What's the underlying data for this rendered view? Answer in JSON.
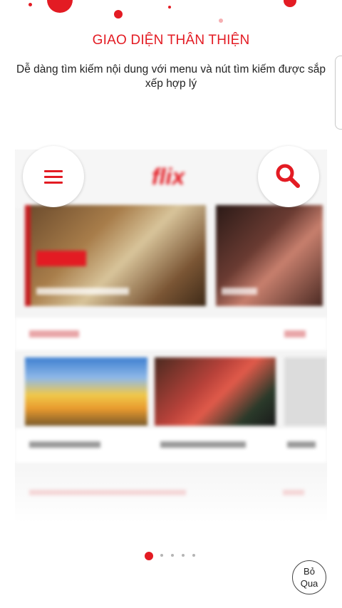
{
  "title": "GIAO DIỆN THÂN THIỆN",
  "subtitle": "Dễ dàng tìm kiếm nội dung với menu và nút tìm kiếm được sắp xếp hợp lý",
  "preview": {
    "logo": "flix"
  },
  "pager": {
    "total": 5,
    "active_index": 0
  },
  "skip_button": {
    "line1": "Bỏ",
    "line2": "Qua"
  },
  "icons": {
    "menu": "hamburger-menu-icon",
    "search": "magnifier-icon"
  },
  "colors": {
    "accent": "#e31b23",
    "text": "#222222",
    "inactive_dot": "#b5b5b5"
  }
}
